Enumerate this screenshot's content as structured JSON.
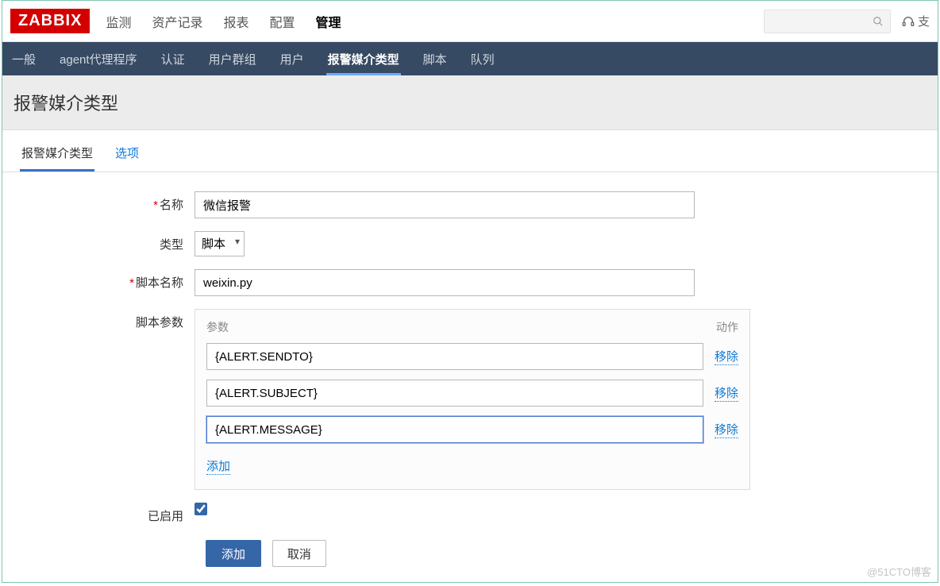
{
  "brand": "ZABBIX",
  "top_menu": {
    "monitoring": "监测",
    "inventory": "资产记录",
    "reports": "报表",
    "config": "配置",
    "admin": "管理"
  },
  "support": "支",
  "sub_menu": {
    "general": "一般",
    "proxies": "agent代理程序",
    "auth": "认证",
    "usergroups": "用户群组",
    "users": "用户",
    "mediatypes": "报警媒介类型",
    "scripts": "脚本",
    "queue": "队列"
  },
  "page_heading": "报警媒介类型",
  "tabs": {
    "mediatype": "报警媒介类型",
    "options": "选项"
  },
  "form": {
    "name_label": "名称",
    "name_value": "微信报警",
    "type_label": "类型",
    "type_value": "脚本",
    "scriptname_label": "脚本名称",
    "scriptname_value": "weixin.py",
    "params_label": "脚本参数",
    "params_head_param": "参数",
    "params_head_action": "动作",
    "params": [
      {
        "value": "{ALERT.SENDTO}",
        "remove": "移除"
      },
      {
        "value": "{ALERT.SUBJECT}",
        "remove": "移除"
      },
      {
        "value": "{ALERT.MESSAGE}",
        "remove": "移除"
      }
    ],
    "add_param": "添加",
    "enabled_label": "已启用",
    "submit": "添加",
    "cancel": "取消"
  },
  "watermark": "@51CTO博客"
}
